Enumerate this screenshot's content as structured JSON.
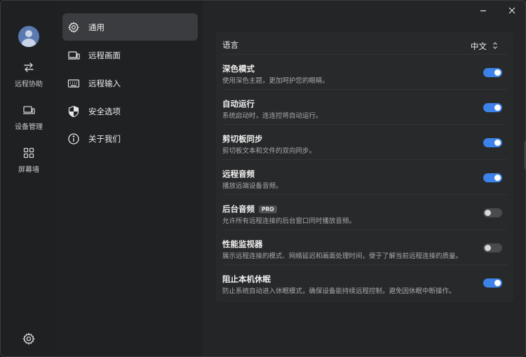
{
  "rail": {
    "items": [
      {
        "label": "远程协助",
        "icon": "swap-arrows-icon"
      },
      {
        "label": "设备管理",
        "icon": "device-icon"
      },
      {
        "label": "屏幕墙",
        "icon": "grid-icon"
      }
    ],
    "settings_icon": "gear-icon"
  },
  "nav": {
    "items": [
      {
        "label": "通用",
        "icon": "gear-icon",
        "active": true
      },
      {
        "label": "远程画面",
        "icon": "display-icon"
      },
      {
        "label": "远程输入",
        "icon": "keyboard-icon"
      },
      {
        "label": "安全选项",
        "icon": "shield-icon"
      },
      {
        "label": "关于我们",
        "icon": "info-icon"
      }
    ]
  },
  "settings": {
    "language": {
      "label": "语言",
      "value": "中文"
    },
    "rows": [
      {
        "title": "深色模式",
        "desc": "使用深色主题，更加呵护您的眼睛。",
        "on": true
      },
      {
        "title": "自动运行",
        "desc": "系统启动时，连连控将自动运行。",
        "on": true
      },
      {
        "title": "剪切板同步",
        "desc": "剪切板文本和文件的双向同步。",
        "on": true
      },
      {
        "title": "远程音频",
        "desc": "播放远端设备音频。",
        "on": true
      },
      {
        "title": "后台音频",
        "badge": "PRO",
        "desc": "允许所有远程连接的后台窗口同时播放音频。",
        "on": false
      },
      {
        "title": "性能监视器",
        "desc": "展示远程连接的模式、网络延迟和画面处理时间，便于了解当前远程连接的质量。",
        "on": false
      },
      {
        "title": "阻止本机休眠",
        "desc": "防止系统自动进入休眠模式，确保设备能持续远程控制，避免因休眠中断操作。",
        "on": true
      }
    ]
  },
  "colors": {
    "accent": "#3c82e8",
    "background": "#242527",
    "panel": "#28292b"
  }
}
